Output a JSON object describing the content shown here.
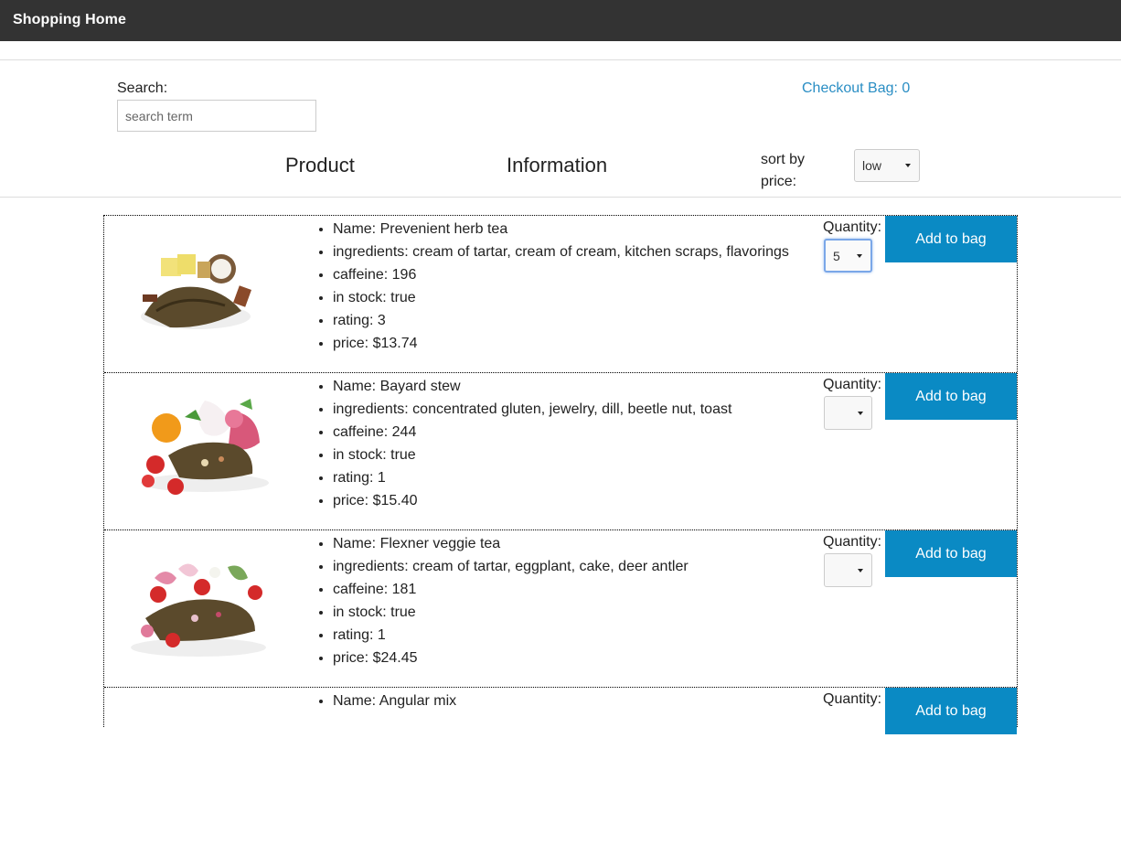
{
  "header": {
    "brand": "Shopping Home"
  },
  "search": {
    "label": "Search:",
    "placeholder": "search term",
    "value": ""
  },
  "checkout": {
    "label": "Checkout Bag: 0"
  },
  "columns": {
    "product": "Product",
    "information": "Information"
  },
  "sort": {
    "label": "sort by price:",
    "selected": "low"
  },
  "colors": {
    "accent": "#0a8ac4",
    "link": "#2a8ec4",
    "topbar": "#333333"
  },
  "products": [
    {
      "name": "Name: Prevenient herb tea",
      "ingredients": "ingredients: cream of tartar, cream of cream, kitchen scraps, flavorings",
      "caffeine": "caffeine: 196",
      "in_stock": "in stock: true",
      "rating": "rating: 3",
      "price": "price: $13.74",
      "quantity_label": "Quantity:",
      "quantity": "5",
      "add_label": "Add to bag"
    },
    {
      "name": "Name: Bayard stew",
      "ingredients": "ingredients: concentrated gluten, jewelry, dill, beetle nut, toast",
      "caffeine": "caffeine: 244",
      "in_stock": "in stock: true",
      "rating": "rating: 1",
      "price": "price: $15.40",
      "quantity_label": "Quantity:",
      "quantity": "",
      "add_label": "Add to bag"
    },
    {
      "name": "Name: Flexner veggie tea",
      "ingredients": "ingredients: cream of tartar, eggplant, cake, deer antler",
      "caffeine": "caffeine: 181",
      "in_stock": "in stock: true",
      "rating": "rating: 1",
      "price": "price: $24.45",
      "quantity_label": "Quantity:",
      "quantity": "",
      "add_label": "Add to bag"
    },
    {
      "name": "Name: Angular mix",
      "quantity_label": "Quantity:",
      "add_label": "Add to bag"
    }
  ]
}
